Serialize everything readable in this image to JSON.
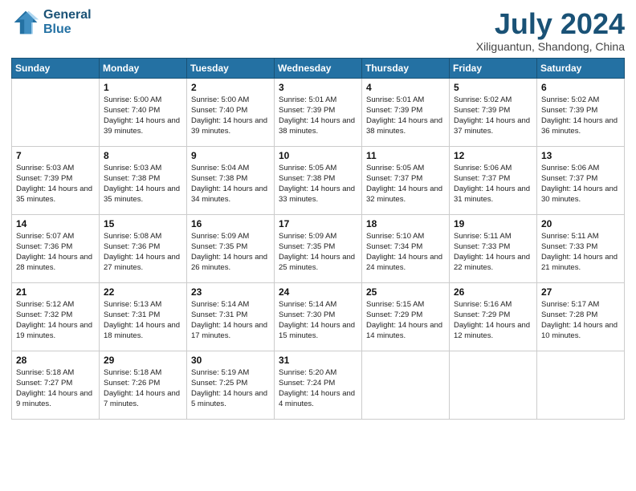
{
  "logo": {
    "line1": "General",
    "line2": "Blue"
  },
  "title": "July 2024",
  "subtitle": "Xiliguantun, Shandong, China",
  "headers": [
    "Sunday",
    "Monday",
    "Tuesday",
    "Wednesday",
    "Thursday",
    "Friday",
    "Saturday"
  ],
  "weeks": [
    [
      {
        "day": "",
        "sunrise": "",
        "sunset": "",
        "daylight": ""
      },
      {
        "day": "1",
        "sunrise": "Sunrise: 5:00 AM",
        "sunset": "Sunset: 7:40 PM",
        "daylight": "Daylight: 14 hours and 39 minutes."
      },
      {
        "day": "2",
        "sunrise": "Sunrise: 5:00 AM",
        "sunset": "Sunset: 7:40 PM",
        "daylight": "Daylight: 14 hours and 39 minutes."
      },
      {
        "day": "3",
        "sunrise": "Sunrise: 5:01 AM",
        "sunset": "Sunset: 7:39 PM",
        "daylight": "Daylight: 14 hours and 38 minutes."
      },
      {
        "day": "4",
        "sunrise": "Sunrise: 5:01 AM",
        "sunset": "Sunset: 7:39 PM",
        "daylight": "Daylight: 14 hours and 38 minutes."
      },
      {
        "day": "5",
        "sunrise": "Sunrise: 5:02 AM",
        "sunset": "Sunset: 7:39 PM",
        "daylight": "Daylight: 14 hours and 37 minutes."
      },
      {
        "day": "6",
        "sunrise": "Sunrise: 5:02 AM",
        "sunset": "Sunset: 7:39 PM",
        "daylight": "Daylight: 14 hours and 36 minutes."
      }
    ],
    [
      {
        "day": "7",
        "sunrise": "Sunrise: 5:03 AM",
        "sunset": "Sunset: 7:39 PM",
        "daylight": "Daylight: 14 hours and 35 minutes."
      },
      {
        "day": "8",
        "sunrise": "Sunrise: 5:03 AM",
        "sunset": "Sunset: 7:38 PM",
        "daylight": "Daylight: 14 hours and 35 minutes."
      },
      {
        "day": "9",
        "sunrise": "Sunrise: 5:04 AM",
        "sunset": "Sunset: 7:38 PM",
        "daylight": "Daylight: 14 hours and 34 minutes."
      },
      {
        "day": "10",
        "sunrise": "Sunrise: 5:05 AM",
        "sunset": "Sunset: 7:38 PM",
        "daylight": "Daylight: 14 hours and 33 minutes."
      },
      {
        "day": "11",
        "sunrise": "Sunrise: 5:05 AM",
        "sunset": "Sunset: 7:37 PM",
        "daylight": "Daylight: 14 hours and 32 minutes."
      },
      {
        "day": "12",
        "sunrise": "Sunrise: 5:06 AM",
        "sunset": "Sunset: 7:37 PM",
        "daylight": "Daylight: 14 hours and 31 minutes."
      },
      {
        "day": "13",
        "sunrise": "Sunrise: 5:06 AM",
        "sunset": "Sunset: 7:37 PM",
        "daylight": "Daylight: 14 hours and 30 minutes."
      }
    ],
    [
      {
        "day": "14",
        "sunrise": "Sunrise: 5:07 AM",
        "sunset": "Sunset: 7:36 PM",
        "daylight": "Daylight: 14 hours and 28 minutes."
      },
      {
        "day": "15",
        "sunrise": "Sunrise: 5:08 AM",
        "sunset": "Sunset: 7:36 PM",
        "daylight": "Daylight: 14 hours and 27 minutes."
      },
      {
        "day": "16",
        "sunrise": "Sunrise: 5:09 AM",
        "sunset": "Sunset: 7:35 PM",
        "daylight": "Daylight: 14 hours and 26 minutes."
      },
      {
        "day": "17",
        "sunrise": "Sunrise: 5:09 AM",
        "sunset": "Sunset: 7:35 PM",
        "daylight": "Daylight: 14 hours and 25 minutes."
      },
      {
        "day": "18",
        "sunrise": "Sunrise: 5:10 AM",
        "sunset": "Sunset: 7:34 PM",
        "daylight": "Daylight: 14 hours and 24 minutes."
      },
      {
        "day": "19",
        "sunrise": "Sunrise: 5:11 AM",
        "sunset": "Sunset: 7:33 PM",
        "daylight": "Daylight: 14 hours and 22 minutes."
      },
      {
        "day": "20",
        "sunrise": "Sunrise: 5:11 AM",
        "sunset": "Sunset: 7:33 PM",
        "daylight": "Daylight: 14 hours and 21 minutes."
      }
    ],
    [
      {
        "day": "21",
        "sunrise": "Sunrise: 5:12 AM",
        "sunset": "Sunset: 7:32 PM",
        "daylight": "Daylight: 14 hours and 19 minutes."
      },
      {
        "day": "22",
        "sunrise": "Sunrise: 5:13 AM",
        "sunset": "Sunset: 7:31 PM",
        "daylight": "Daylight: 14 hours and 18 minutes."
      },
      {
        "day": "23",
        "sunrise": "Sunrise: 5:14 AM",
        "sunset": "Sunset: 7:31 PM",
        "daylight": "Daylight: 14 hours and 17 minutes."
      },
      {
        "day": "24",
        "sunrise": "Sunrise: 5:14 AM",
        "sunset": "Sunset: 7:30 PM",
        "daylight": "Daylight: 14 hours and 15 minutes."
      },
      {
        "day": "25",
        "sunrise": "Sunrise: 5:15 AM",
        "sunset": "Sunset: 7:29 PM",
        "daylight": "Daylight: 14 hours and 14 minutes."
      },
      {
        "day": "26",
        "sunrise": "Sunrise: 5:16 AM",
        "sunset": "Sunset: 7:29 PM",
        "daylight": "Daylight: 14 hours and 12 minutes."
      },
      {
        "day": "27",
        "sunrise": "Sunrise: 5:17 AM",
        "sunset": "Sunset: 7:28 PM",
        "daylight": "Daylight: 14 hours and 10 minutes."
      }
    ],
    [
      {
        "day": "28",
        "sunrise": "Sunrise: 5:18 AM",
        "sunset": "Sunset: 7:27 PM",
        "daylight": "Daylight: 14 hours and 9 minutes."
      },
      {
        "day": "29",
        "sunrise": "Sunrise: 5:18 AM",
        "sunset": "Sunset: 7:26 PM",
        "daylight": "Daylight: 14 hours and 7 minutes."
      },
      {
        "day": "30",
        "sunrise": "Sunrise: 5:19 AM",
        "sunset": "Sunset: 7:25 PM",
        "daylight": "Daylight: 14 hours and 5 minutes."
      },
      {
        "day": "31",
        "sunrise": "Sunrise: 5:20 AM",
        "sunset": "Sunset: 7:24 PM",
        "daylight": "Daylight: 14 hours and 4 minutes."
      },
      {
        "day": "",
        "sunrise": "",
        "sunset": "",
        "daylight": ""
      },
      {
        "day": "",
        "sunrise": "",
        "sunset": "",
        "daylight": ""
      },
      {
        "day": "",
        "sunrise": "",
        "sunset": "",
        "daylight": ""
      }
    ]
  ]
}
